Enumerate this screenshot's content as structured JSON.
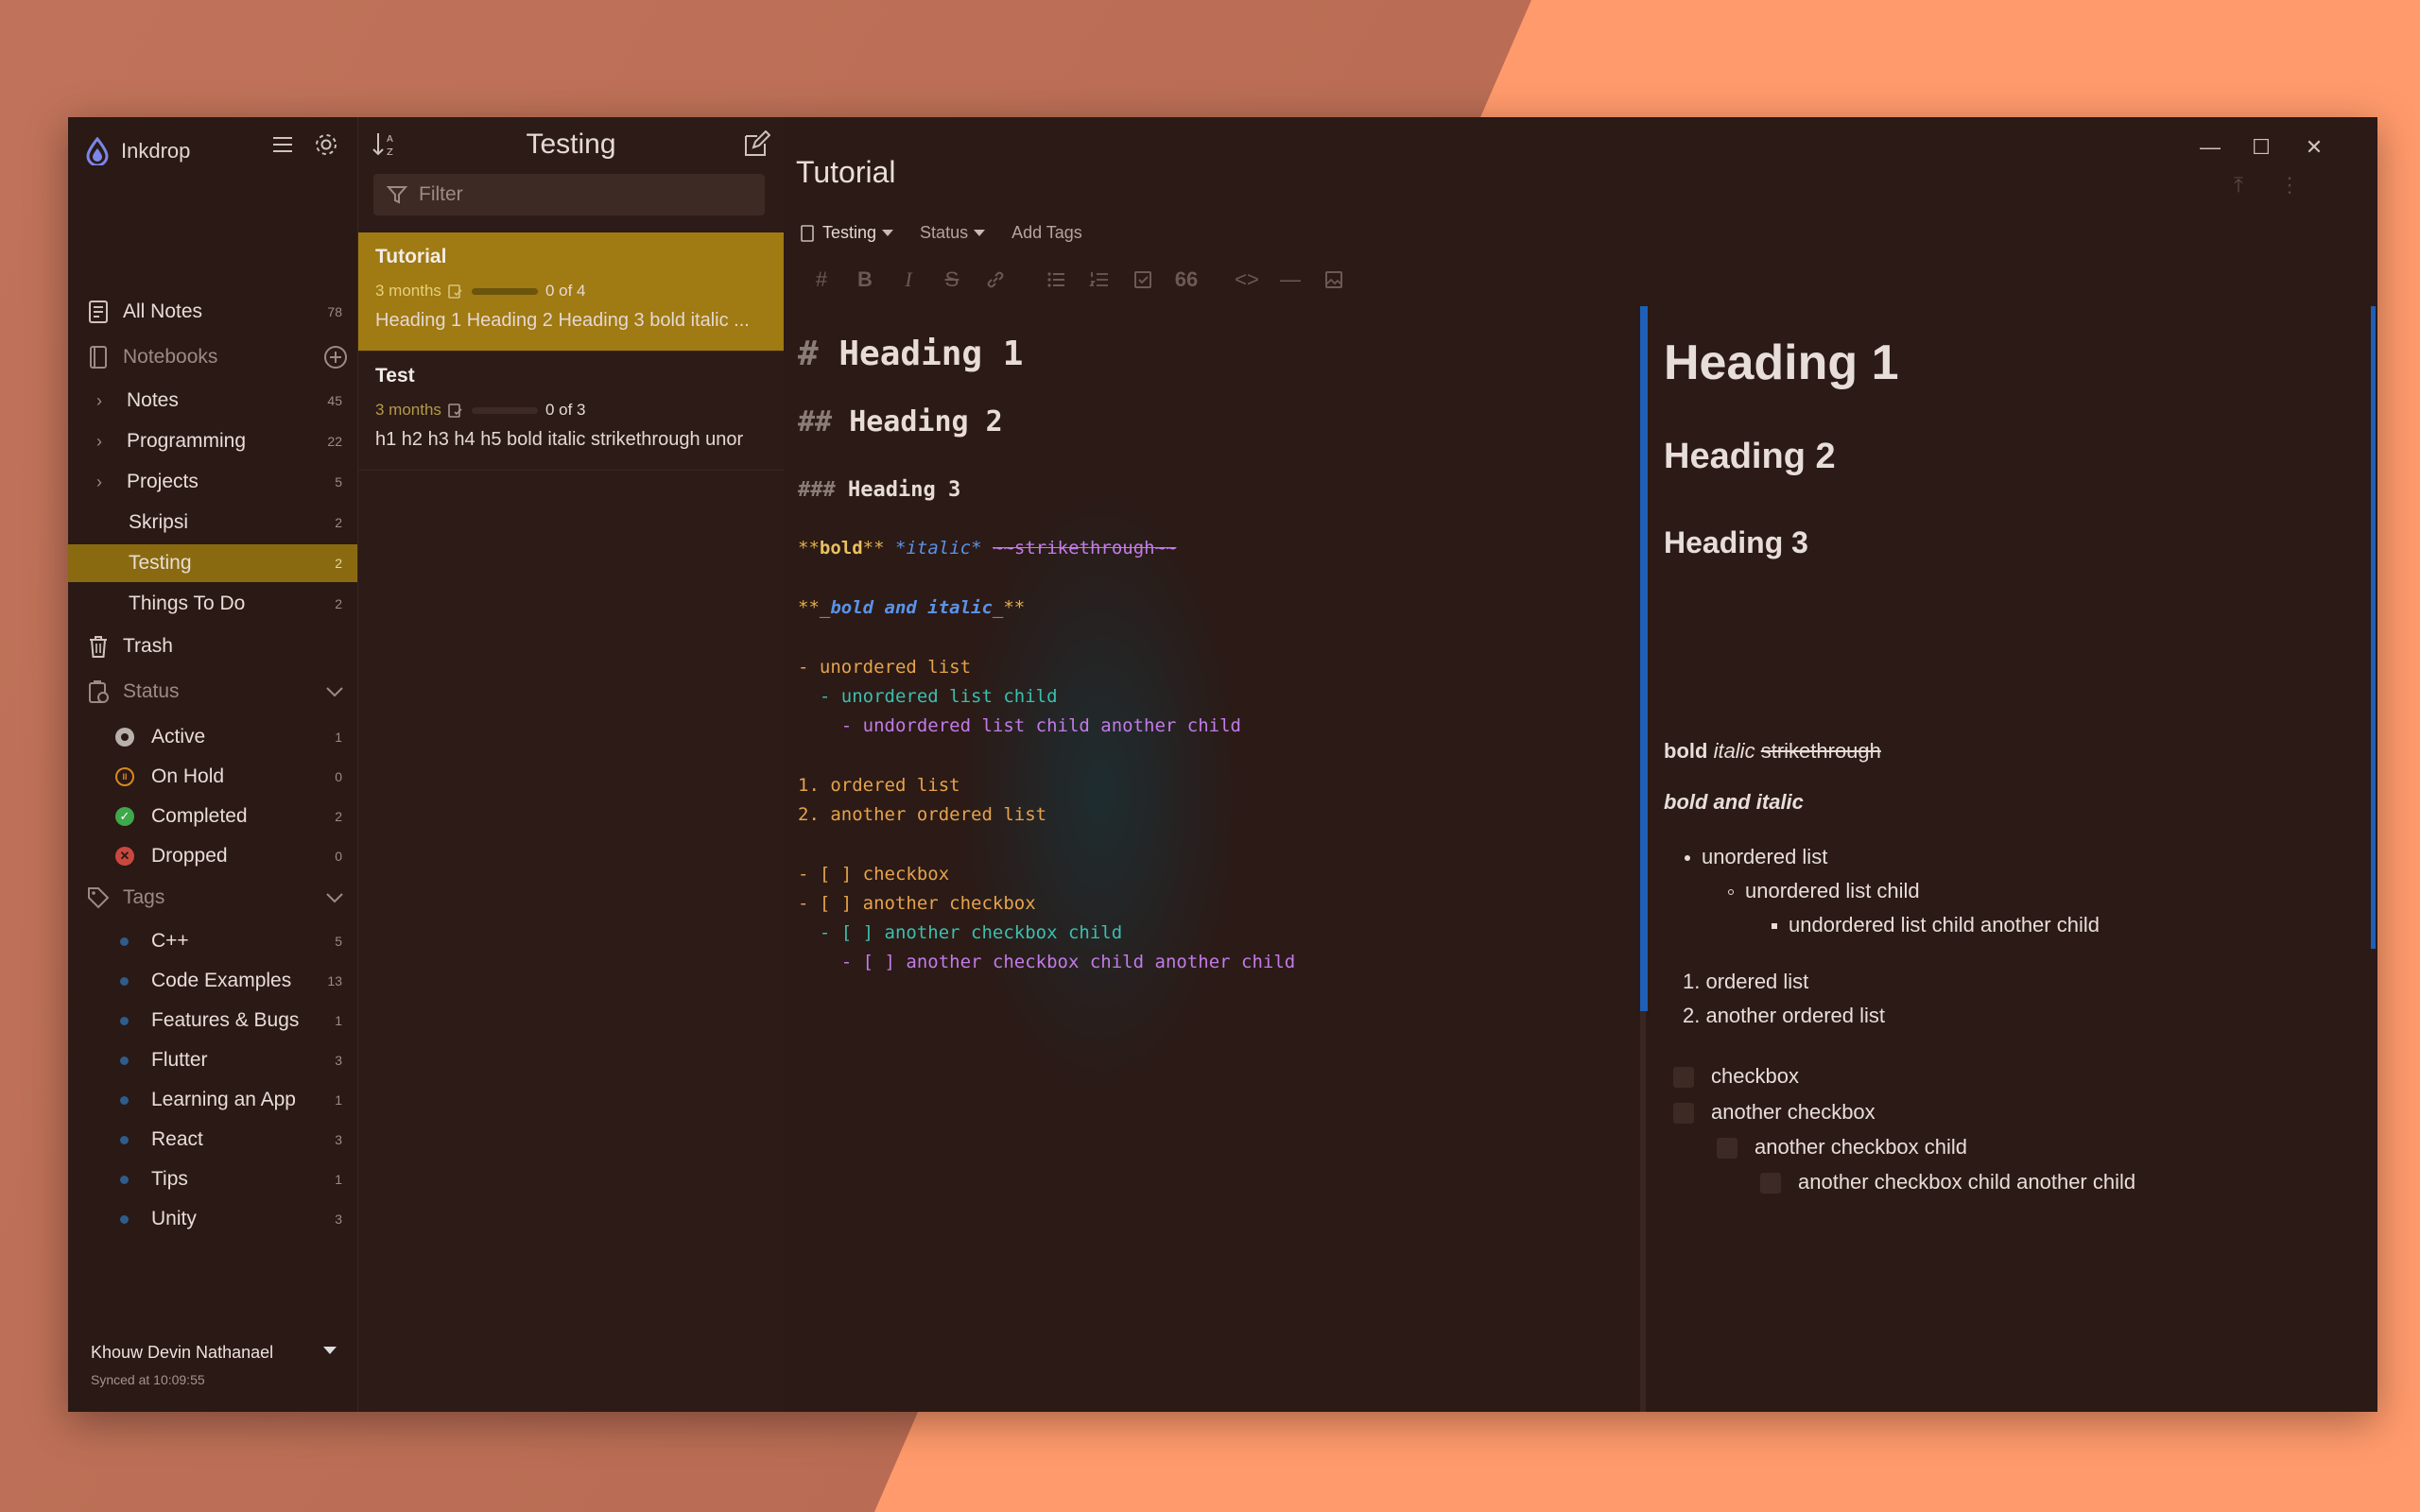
{
  "app": {
    "name": "Inkdrop"
  },
  "sidebar": {
    "all_notes": {
      "label": "All Notes",
      "count": "78"
    },
    "notebooks_label": "Notebooks",
    "notebooks": [
      {
        "label": "Notes",
        "count": "45",
        "expandable": true
      },
      {
        "label": "Programming",
        "count": "22",
        "expandable": true
      },
      {
        "label": "Projects",
        "count": "5",
        "expandable": true
      },
      {
        "label": "Skripsi",
        "count": "2",
        "expandable": false
      },
      {
        "label": "Testing",
        "count": "2",
        "expandable": false,
        "active": true
      },
      {
        "label": "Things To Do",
        "count": "2",
        "expandable": false
      }
    ],
    "trash_label": "Trash",
    "status_label": "Status",
    "statuses": [
      {
        "label": "Active",
        "count": "1",
        "color": "#b8b0aa"
      },
      {
        "label": "On Hold",
        "count": "0",
        "color": "#d98a1c"
      },
      {
        "label": "Completed",
        "count": "2",
        "color": "#3ea84a"
      },
      {
        "label": "Dropped",
        "count": "0",
        "color": "#c9483e"
      }
    ],
    "tags_label": "Tags",
    "tags": [
      {
        "label": "C++",
        "count": "5"
      },
      {
        "label": "Code Examples",
        "count": "13"
      },
      {
        "label": "Features & Bugs",
        "count": "1"
      },
      {
        "label": "Flutter",
        "count": "3"
      },
      {
        "label": "Learning an App",
        "count": "1"
      },
      {
        "label": "React",
        "count": "3"
      },
      {
        "label": "Tips",
        "count": "1"
      },
      {
        "label": "Unity",
        "count": "3"
      }
    ],
    "user": {
      "name": "Khouw Devin Nathanael",
      "sync": "Synced at 10:09:55"
    }
  },
  "notelist": {
    "title": "Testing",
    "filter_placeholder": "Filter",
    "notes": [
      {
        "title": "Tutorial",
        "date": "3 months",
        "tasks": "0 of 4",
        "progress": 0,
        "excerpt": "Heading 1 Heading 2 Heading 3 bold italic ...",
        "selected": true
      },
      {
        "title": "Test",
        "date": "3 months",
        "tasks": "0 of 3",
        "progress": 0,
        "excerpt": "h1 h2 h3 h4 h5 bold italic strikethrough unor",
        "selected": false
      }
    ]
  },
  "editor": {
    "title": "Tutorial",
    "notebook": "Testing",
    "status": "Status",
    "add_tags": "Add Tags",
    "code": {
      "h1_hash": "#",
      "h1": "Heading 1",
      "h2_hash": "##",
      "h2": "Heading 2",
      "h3_hash": "###",
      "h3": "Heading 3",
      "bold_mark": "**",
      "bold": "bold",
      "italic_mark": "*",
      "italic": "italic",
      "strike": "~~strikethrough~~",
      "bi_open": "**_",
      "bi": "bold and italic",
      "bi_close": "_**",
      "ul1": "- unordered list",
      "ul2": "  - unordered list child",
      "ul3": "    - undordered list child another child",
      "ol1": "1. ordered list",
      "ol2": "2. another ordered list",
      "cb1_mark": "- [ ]",
      "cb1": "checkbox",
      "cb2_mark": "- [ ]",
      "cb2": "another checkbox",
      "cb3_mark": "  - [ ]",
      "cb3": "another checkbox child",
      "cb4_mark": "    - [ ]",
      "cb4": "another checkbox child another child"
    },
    "preview": {
      "h1": "Heading 1",
      "h2": "Heading 2",
      "h3": "Heading 3",
      "bold": "bold",
      "italic": "italic",
      "strike": "strikethrough",
      "bold_italic": "bold and italic",
      "ul1": "unordered list",
      "ul2": "unordered list child",
      "ul3": "undordered list child another child",
      "ol1": "1. ordered list",
      "ol2": "2. another ordered list",
      "cb1": "checkbox",
      "cb2": "another checkbox",
      "cb3": "another checkbox child",
      "cb4": "another checkbox child another child"
    }
  }
}
